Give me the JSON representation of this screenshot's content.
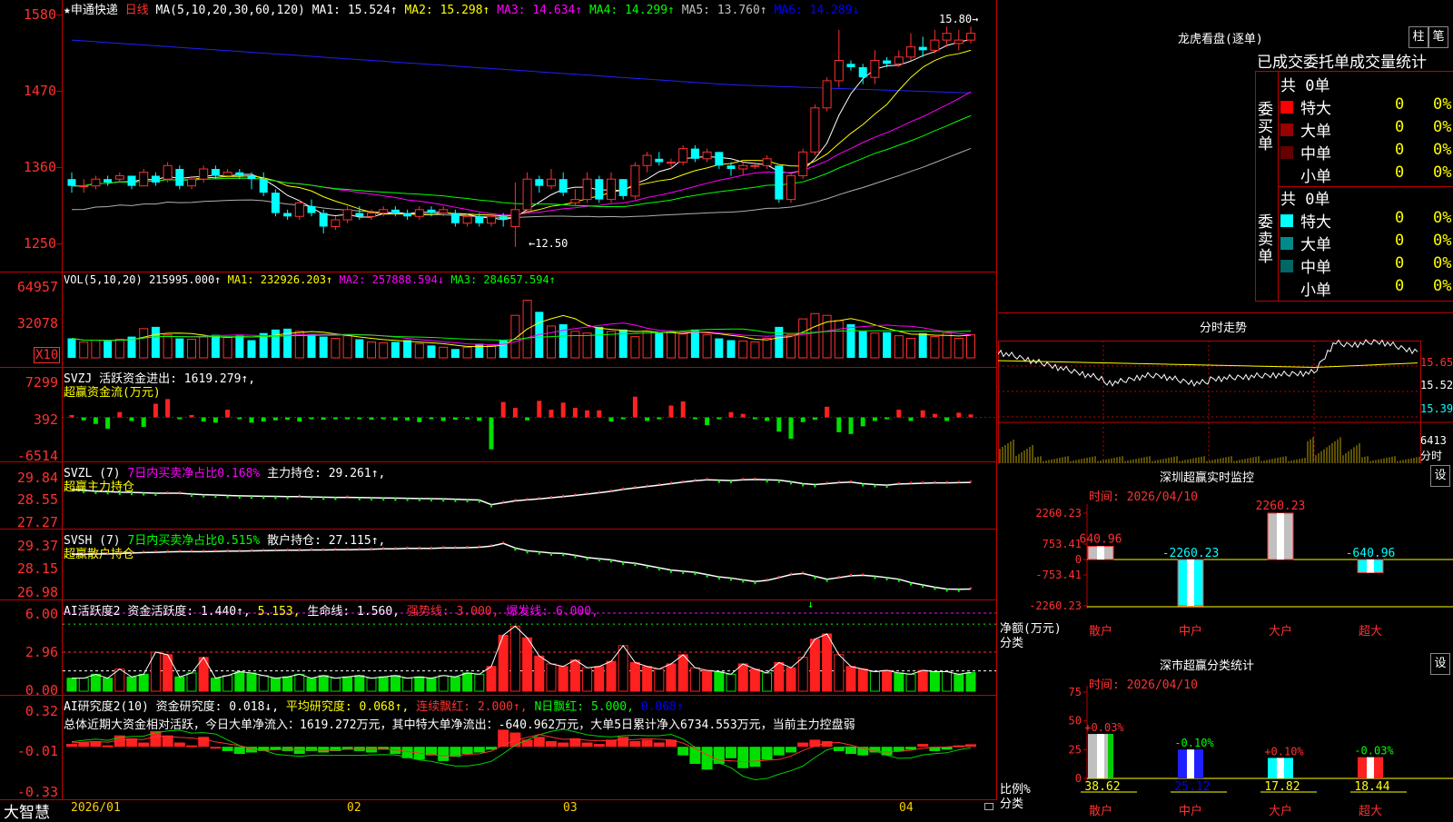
{
  "left": {
    "stock_title": "★申通快递",
    "period": "日线",
    "ma_head": "MA(5,10,20,30,60,120)",
    "ma_values": [
      {
        "label": "MA1: 15.524↑",
        "color": "#ffffff"
      },
      {
        "label": "MA2: 15.298↑",
        "color": "#ffff00"
      },
      {
        "label": "MA3: 14.634↑",
        "color": "#ff00ff"
      },
      {
        "label": "MA4: 14.299↑",
        "color": "#00ff00"
      },
      {
        "label": "MA5: 13.760↑",
        "color": "#c0c0c0"
      },
      {
        "label": "MA6: 14.289↓",
        "color": "#0000ff"
      }
    ],
    "high_label": "15.80→",
    "low_label": "←12.50",
    "price_ticks": [
      "1580",
      "1470",
      "1360",
      "1250"
    ],
    "vol": {
      "header": "VOL(5,10,20)",
      "value": "215995.000↑",
      "ma1": "MA1: 232926.203↑",
      "ma2": "MA2: 257888.594↓",
      "ma3": "MA3: 284657.594↑",
      "ticks": [
        "64957",
        "32078"
      ],
      "unit": "X10"
    },
    "svzj": {
      "header": "SVZJ",
      "text": "活跃资金进出: 1619.279↑,",
      "sub": "超赢资金流(万元)",
      "ticks": [
        "7299",
        "392",
        "-6514"
      ]
    },
    "svzl": {
      "header": "SVZL (7)",
      "text1": "7日内买卖净占比0.168%",
      "text2": "主力持仓: 29.261↑,",
      "sub": "超赢主力持仓",
      "ticks": [
        "29.84",
        "28.55",
        "27.27"
      ]
    },
    "svsh": {
      "header": "SVSH (7)",
      "text1": "7日内买卖净占比0.515%",
      "text2": "散户持仓: 27.115↑,",
      "sub": "超赢散户持仓",
      "ticks": [
        "29.37",
        "28.15",
        "26.98"
      ]
    },
    "ai_active": {
      "header": "AI活跃度2",
      "t1": "资金活跃度: 1.440↑,",
      "t2": "5.153,",
      "t3": "生命线: 1.560,",
      "t4": "强势线: 3.000,",
      "t5": "爆发线: 6.000,",
      "ticks": [
        "6.00",
        "2.96",
        "0.00"
      ]
    },
    "ai_research": {
      "header": "AI研究度2(10)",
      "t1": "资金研究度: 0.018↓,",
      "t2": "平均研究度: 0.068↑,",
      "t3": "连续飘红: 2.000↑,",
      "t4": "N日飘红: 5.000,",
      "t5": "0.068↑",
      "summary": "总体近期大资金相对活跃，今日大单净流入：1619.272万元，其中特大单净流出：-640.962万元，大单5日累计净入6734.553万元，当前主力控盘弱",
      "ticks": [
        "0.32",
        "-0.01",
        "-0.33"
      ]
    },
    "x_axis": [
      "2026/01",
      "02",
      "03",
      "04"
    ],
    "brand": "大智慧"
  },
  "right": {
    "dragon": {
      "title": "龙虎看盘(逐单)",
      "btn1": "柱",
      "btn2": "笔",
      "subtitle": "已成交委托单成交量统计",
      "buy_label": "委买单",
      "sell_label": "委卖单",
      "buy_total": "共 0单",
      "sell_total": "共 0单",
      "buy_rows": [
        {
          "name": "特大",
          "count": "0",
          "pct": "0%",
          "color": "#ff0000"
        },
        {
          "name": "大单",
          "count": "0",
          "pct": "0%",
          "color": "#990000"
        },
        {
          "name": "中单",
          "count": "0",
          "pct": "0%",
          "color": "#660000"
        },
        {
          "name": "小单",
          "count": "0",
          "pct": "0%",
          "color": "#000000"
        }
      ],
      "sell_rows": [
        {
          "name": "特大",
          "count": "0",
          "pct": "0%",
          "color": "#00ffff"
        },
        {
          "name": "大单",
          "count": "0",
          "pct": "0%",
          "color": "#008b8b"
        },
        {
          "name": "中单",
          "count": "0",
          "pct": "0%",
          "color": "#006666"
        },
        {
          "name": "小单",
          "count": "0",
          "pct": "0%",
          "color": "#000000"
        }
      ]
    },
    "intraday": {
      "title": "分时走势",
      "ticks": [
        "15.65",
        "15.52",
        "15.39"
      ],
      "vol_tick": "6413",
      "vol_unit": "分时"
    },
    "monitor": {
      "title": "深圳超赢实时监控",
      "btn": "设",
      "time": "时间: 2026/04/10",
      "ticks": [
        "2260.23",
        "753.41",
        "0",
        "-753.41",
        "-2260.23"
      ],
      "ylabel1": "净额(万元)",
      "ylabel2": "分类",
      "categories": [
        "散户",
        "中户",
        "大户",
        "超大"
      ],
      "bar_labels": [
        "640.96",
        "-2260.23",
        "2260.23",
        "-640.96"
      ]
    },
    "classify": {
      "title": "深市超赢分类统计",
      "btn": "设",
      "time": "时间: 2026/04/10",
      "ticks": [
        "75",
        "50",
        "25",
        "0"
      ],
      "ylabel1": "比例%",
      "ylabel2": "分类",
      "categories": [
        "散户",
        "中户",
        "大户",
        "超大"
      ],
      "change_labels": [
        "+0.03%",
        "-0.10%",
        "+0.10%",
        "-0.03%"
      ],
      "values_text": [
        "38.62",
        "25.12",
        "17.82",
        "18.44"
      ]
    }
  },
  "chart_data": [
    {
      "type": "candlestick",
      "title": "申通快递 日线",
      "ylim": [
        12.2,
        15.95
      ],
      "x_ticks": [
        "2026/01",
        "02",
        "03",
        "04"
      ],
      "ohlc": [
        [
          13.55,
          13.65,
          13.35,
          13.45
        ],
        [
          13.45,
          13.55,
          13.35,
          13.45
        ],
        [
          13.45,
          13.6,
          13.4,
          13.55
        ],
        [
          13.55,
          13.6,
          13.45,
          13.5
        ],
        [
          13.55,
          13.65,
          13.5,
          13.6
        ],
        [
          13.6,
          13.6,
          13.4,
          13.45
        ],
        [
          13.45,
          13.7,
          13.45,
          13.65
        ],
        [
          13.6,
          13.65,
          13.45,
          13.5
        ],
        [
          13.55,
          13.8,
          13.5,
          13.75
        ],
        [
          13.7,
          13.75,
          13.4,
          13.45
        ],
        [
          13.45,
          13.6,
          13.4,
          13.55
        ],
        [
          13.55,
          13.75,
          13.5,
          13.7
        ],
        [
          13.7,
          13.75,
          13.55,
          13.6
        ],
        [
          13.6,
          13.7,
          13.55,
          13.65
        ],
        [
          13.65,
          13.7,
          13.55,
          13.6
        ],
        [
          13.6,
          13.65,
          13.4,
          13.55
        ],
        [
          13.55,
          13.65,
          13.3,
          13.35
        ],
        [
          13.35,
          13.4,
          13.0,
          13.05
        ],
        [
          13.05,
          13.1,
          12.95,
          13.0
        ],
        [
          13.0,
          13.25,
          12.95,
          13.2
        ],
        [
          13.15,
          13.25,
          13.0,
          13.05
        ],
        [
          13.05,
          13.1,
          12.75,
          12.85
        ],
        [
          12.85,
          13.0,
          12.8,
          12.95
        ],
        [
          12.95,
          13.15,
          12.9,
          13.1
        ],
        [
          13.05,
          13.15,
          12.95,
          13.0
        ],
        [
          13.0,
          13.1,
          12.95,
          13.05
        ],
        [
          13.05,
          13.15,
          13.0,
          13.1
        ],
        [
          13.1,
          13.15,
          13.0,
          13.05
        ],
        [
          13.05,
          13.1,
          12.95,
          13.0
        ],
        [
          13.0,
          13.15,
          12.95,
          13.1
        ],
        [
          13.1,
          13.15,
          13.0,
          13.05
        ],
        [
          13.05,
          13.15,
          13.0,
          13.1
        ],
        [
          13.05,
          13.1,
          12.85,
          12.9
        ],
        [
          12.9,
          13.05,
          12.85,
          13.0
        ],
        [
          13.0,
          13.05,
          12.85,
          12.9
        ],
        [
          12.9,
          13.05,
          12.85,
          13.0
        ],
        [
          13.0,
          13.05,
          12.85,
          12.95
        ],
        [
          12.85,
          13.5,
          12.55,
          13.1
        ],
        [
          13.1,
          13.65,
          13.05,
          13.55
        ],
        [
          13.55,
          13.6,
          13.35,
          13.45
        ],
        [
          13.45,
          13.7,
          13.4,
          13.55
        ],
        [
          13.55,
          13.65,
          13.3,
          13.35
        ],
        [
          13.2,
          13.4,
          13.15,
          13.25
        ],
        [
          13.25,
          13.65,
          13.2,
          13.55
        ],
        [
          13.55,
          13.6,
          13.2,
          13.25
        ],
        [
          13.25,
          13.65,
          13.2,
          13.55
        ],
        [
          13.55,
          13.55,
          13.25,
          13.3
        ],
        [
          13.3,
          13.8,
          13.25,
          13.75
        ],
        [
          13.75,
          13.95,
          13.65,
          13.9
        ],
        [
          13.85,
          13.95,
          13.75,
          13.8
        ],
        [
          13.8,
          13.85,
          13.7,
          13.8
        ],
        [
          13.8,
          14.05,
          13.75,
          14.0
        ],
        [
          14.0,
          14.05,
          13.8,
          13.85
        ],
        [
          13.85,
          14.0,
          13.8,
          13.95
        ],
        [
          13.95,
          13.95,
          13.7,
          13.75
        ],
        [
          13.75,
          13.8,
          13.6,
          13.7
        ],
        [
          13.7,
          13.8,
          13.6,
          13.75
        ],
        [
          13.75,
          13.8,
          13.7,
          13.75
        ],
        [
          13.75,
          13.9,
          13.7,
          13.85
        ],
        [
          13.75,
          13.75,
          13.2,
          13.25
        ],
        [
          13.25,
          13.65,
          13.2,
          13.6
        ],
        [
          13.6,
          14.0,
          13.55,
          13.95
        ],
        [
          13.95,
          14.65,
          13.9,
          14.6
        ],
        [
          14.6,
          15.05,
          14.55,
          15.0
        ],
        [
          15.0,
          15.75,
          14.9,
          15.3
        ],
        [
          15.25,
          15.3,
          15.15,
          15.2
        ],
        [
          15.2,
          15.25,
          14.95,
          15.05
        ],
        [
          15.05,
          15.45,
          14.95,
          15.3
        ],
        [
          15.3,
          15.35,
          15.2,
          15.25
        ],
        [
          15.25,
          15.45,
          15.2,
          15.35
        ],
        [
          15.35,
          15.7,
          15.3,
          15.5
        ],
        [
          15.5,
          15.65,
          15.35,
          15.45
        ],
        [
          15.45,
          15.75,
          15.4,
          15.6
        ],
        [
          15.6,
          15.8,
          15.5,
          15.7
        ],
        [
          15.55,
          15.75,
          15.45,
          15.6
        ],
        [
          15.6,
          15.8,
          15.55,
          15.7
        ]
      ]
    },
    {
      "type": "bar",
      "title": "VOL(5,10,20)",
      "unit": "X10",
      "ylim": [
        0,
        80000
      ],
      "values": [
        22000,
        18000,
        20000,
        19000,
        21000,
        24000,
        33000,
        35000,
        26000,
        22000,
        21000,
        24000,
        26000,
        23000,
        25000,
        20000,
        28000,
        32000,
        33000,
        30000,
        26000,
        24000,
        22000,
        25000,
        21000,
        18000,
        17000,
        18000,
        20000,
        16000,
        14000,
        12000,
        10000,
        12000,
        16000,
        14000,
        20000,
        48000,
        65000,
        52000,
        36000,
        38000,
        30000,
        28000,
        35000,
        30000,
        32000,
        24000,
        30000,
        28000,
        29000,
        27000,
        32000,
        26000,
        22000,
        20000,
        19000,
        18000,
        22000,
        35000,
        26000,
        44000,
        50000,
        48000,
        42000,
        38000,
        30000,
        28000,
        29000,
        25000,
        22000,
        28000,
        24000,
        28000,
        22000,
        26000
      ]
    },
    {
      "type": "bar",
      "title": "活跃资金进出",
      "ylim": [
        -6514,
        7299
      ],
      "values": [
        400,
        -500,
        -1100,
        -1900,
        900,
        -600,
        -1600,
        2300,
        3100,
        -200,
        400,
        -700,
        -900,
        1300,
        -300,
        -900,
        -700,
        -500,
        -400,
        -700,
        -200,
        -400,
        -300,
        -200,
        -300,
        -400,
        -200,
        -500,
        -500,
        -800,
        -300,
        -600,
        -400,
        -200,
        -600,
        -5400,
        2600,
        1600,
        -500,
        2800,
        1300,
        2500,
        1600,
        1200,
        1200,
        -700,
        -200,
        3500,
        -600,
        -200,
        2000,
        2700,
        -200,
        -1300,
        -300,
        900,
        600,
        -200,
        -600,
        -2400,
        -3600,
        -800,
        -400,
        1800,
        -2500,
        -2800,
        -1500,
        -600,
        -300,
        1300,
        -600,
        1200,
        600,
        -600,
        800,
        500
      ]
    },
    {
      "type": "line",
      "title": "超赢主力持仓",
      "ylim": [
        27.27,
        29.84
      ],
      "values": [
        28.9,
        28.85,
        28.8,
        28.78,
        28.75,
        28.74,
        28.72,
        28.7,
        28.7,
        28.7,
        28.65,
        28.62,
        28.6,
        28.58,
        28.56,
        28.55,
        28.54,
        28.53,
        28.52,
        28.52,
        28.5,
        28.49,
        28.48,
        28.48,
        28.47,
        28.46,
        28.45,
        28.44,
        28.43,
        28.42,
        28.41,
        28.4,
        28.38,
        28.36,
        28.34,
        28.1,
        28.2,
        28.3,
        28.35,
        28.4,
        28.46,
        28.52,
        28.58,
        28.65,
        28.72,
        28.8,
        28.9,
        28.98,
        29.05,
        29.12,
        29.2,
        29.28,
        29.35,
        29.4,
        29.38,
        29.36,
        29.4,
        29.42,
        29.4,
        29.38,
        29.3,
        29.2,
        29.15,
        29.2,
        29.25,
        29.28,
        29.2,
        29.15,
        29.12,
        29.18,
        29.2,
        29.22,
        29.24,
        29.24,
        29.25,
        29.26
      ]
    },
    {
      "type": "line",
      "title": "超赢散户持仓",
      "ylim": [
        26.98,
        29.37
      ],
      "values": [
        28.65,
        28.65,
        28.66,
        28.66,
        28.68,
        28.7,
        28.72,
        28.73,
        28.75,
        28.76,
        28.76,
        28.76,
        28.77,
        28.78,
        28.78,
        28.79,
        28.8,
        28.81,
        28.82,
        28.82,
        28.83,
        28.83,
        28.84,
        28.84,
        28.85,
        28.86,
        28.88,
        28.88,
        28.9,
        28.9,
        28.9,
        28.92,
        28.92,
        28.93,
        28.95,
        29.0,
        29.12,
        28.92,
        28.8,
        28.75,
        28.7,
        28.68,
        28.6,
        28.5,
        28.45,
        28.4,
        28.3,
        28.25,
        28.15,
        28.05,
        27.95,
        27.9,
        27.85,
        27.75,
        27.65,
        27.6,
        27.52,
        27.45,
        27.5,
        27.62,
        27.75,
        27.8,
        27.68,
        27.55,
        27.62,
        27.7,
        27.72,
        27.68,
        27.62,
        27.55,
        27.4,
        27.3,
        27.2,
        27.12,
        27.11,
        27.12
      ]
    },
    {
      "type": "bar",
      "title": "AI活跃度2",
      "ylim": [
        0,
        6.0
      ],
      "values": [
        1.0,
        1.0,
        1.3,
        1.0,
        1.7,
        1.1,
        1.3,
        3.0,
        2.8,
        1.1,
        1.4,
        2.6,
        1.0,
        1.2,
        1.5,
        1.4,
        1.2,
        1.0,
        1.1,
        1.3,
        1.0,
        1.2,
        1.0,
        1.1,
        1.2,
        1.0,
        1.1,
        1.2,
        1.0,
        1.1,
        1.0,
        1.2,
        1.1,
        1.4,
        1.3,
        1.9,
        4.3,
        5.0,
        4.1,
        2.7,
        2.1,
        1.9,
        2.4,
        1.8,
        1.9,
        2.3,
        3.5,
        2.2,
        1.9,
        1.7,
        2.1,
        2.8,
        1.8,
        1.6,
        1.5,
        1.3,
        2.1,
        1.7,
        1.4,
        2.2,
        1.8,
        2.6,
        4.0,
        4.4,
        2.8,
        1.9,
        1.7,
        1.5,
        1.6,
        1.4,
        1.3,
        1.6,
        1.5,
        1.5,
        1.3,
        1.44
      ]
    },
    {
      "type": "bar",
      "title": "AI研究度2(10)",
      "ylim": [
        -0.33,
        0.32
      ],
      "values": [
        0.02,
        0.03,
        0.04,
        0.01,
        0.08,
        0.06,
        0.03,
        0.11,
        0.08,
        0.03,
        0.01,
        0.07,
        0.0,
        -0.03,
        -0.05,
        -0.04,
        -0.03,
        -0.02,
        -0.03,
        -0.05,
        -0.03,
        -0.04,
        -0.03,
        -0.02,
        -0.03,
        -0.04,
        -0.02,
        -0.05,
        -0.08,
        -0.09,
        -0.06,
        -0.1,
        -0.07,
        -0.05,
        -0.04,
        -0.02,
        0.12,
        0.1,
        0.05,
        0.07,
        0.04,
        0.03,
        0.06,
        0.03,
        0.02,
        0.05,
        0.07,
        0.04,
        0.05,
        0.03,
        0.05,
        -0.06,
        -0.12,
        -0.16,
        -0.12,
        -0.08,
        -0.15,
        -0.14,
        -0.09,
        -0.06,
        -0.04,
        0.03,
        0.05,
        0.04,
        -0.03,
        -0.05,
        -0.06,
        -0.04,
        -0.06,
        -0.03,
        -0.02,
        0.02,
        -0.03,
        -0.02,
        0.01,
        0.018
      ]
    },
    {
      "type": "bar",
      "title": "深圳超赢实时监控",
      "categories": [
        "散户",
        "中户",
        "大户",
        "超大"
      ],
      "values": [
        640.96,
        -2260.23,
        2260.23,
        -640.96
      ],
      "ylabel": "净额(万元)",
      "ylim": [
        -2260.23,
        2260.23
      ]
    },
    {
      "type": "bar",
      "title": "深市超赢分类统计",
      "categories": [
        "散户",
        "中户",
        "大户",
        "超大"
      ],
      "values": [
        38.62,
        25.12,
        17.82,
        18.44
      ],
      "changes": [
        "+0.03%",
        "-0.10%",
        "+0.10%",
        "-0.03%"
      ],
      "ylabel": "比例%",
      "ylim": [
        0,
        75
      ]
    }
  ]
}
